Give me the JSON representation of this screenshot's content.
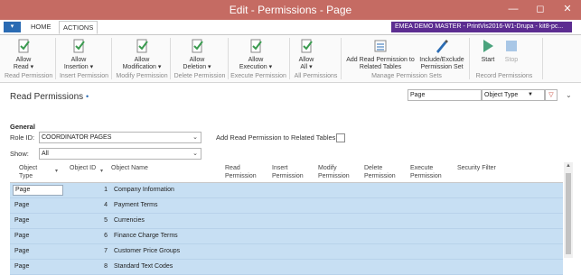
{
  "window": {
    "title": "Edit - Permissions - Page"
  },
  "ribbon_tabs": {
    "home": "HOME",
    "actions": "ACTIONS",
    "app_button": "▾"
  },
  "tenant": "EMEA DEMO MASTER - PrintVis2016-W1-Drupa - kit8-pc...",
  "ribbon": {
    "buttons": [
      {
        "label1": "Allow",
        "label2": "Read ▾",
        "icon": "check-document-icon"
      },
      {
        "label1": "Allow",
        "label2": "Insertion ▾",
        "icon": "check-document-icon"
      },
      {
        "label1": "Allow",
        "label2": "Modification ▾",
        "icon": "check-document-icon"
      },
      {
        "label1": "Allow",
        "label2": "Deletion ▾",
        "icon": "check-document-icon"
      },
      {
        "label1": "Allow",
        "label2": "Execution ▾",
        "icon": "check-document-icon"
      },
      {
        "label1": "Allow",
        "label2": "All ▾",
        "icon": "check-document-icon"
      },
      {
        "label1": "Add Read Permission to",
        "label2": "Related Tables",
        "icon": "list-arrows-icon"
      },
      {
        "label1": "Include/Exclude",
        "label2": "Permission Set",
        "icon": "pen-icon"
      },
      {
        "label1": "Start",
        "label2": "",
        "icon": "play-icon"
      },
      {
        "label1": "Stop",
        "label2": "",
        "icon": "stop-icon"
      }
    ],
    "groups": [
      "Read Permission",
      "Insert Permission",
      "Modify Permission",
      "Delete Permission",
      "Execute Permission",
      "All Permissions",
      "Manage Permission Sets",
      "Record Permissions"
    ]
  },
  "page": {
    "title": "Read Permissions",
    "filter_value": "Page",
    "filter_field": "Object Type"
  },
  "general": {
    "heading": "General",
    "role_id_label": "Role ID:",
    "role_id_value": "COORDINATOR PAGES",
    "show_label": "Show:",
    "show_value": "All",
    "add_related_label": "Add Read Permission to Related Tables:"
  },
  "grid": {
    "columns": [
      {
        "l1": "Object",
        "l2": "Type"
      },
      {
        "l1": "Object ID",
        "l2": ""
      },
      {
        "l1": "Object Name",
        "l2": ""
      },
      {
        "l1": "Read",
        "l2": "Permission"
      },
      {
        "l1": "Insert",
        "l2": "Permission"
      },
      {
        "l1": "Modify",
        "l2": "Permission"
      },
      {
        "l1": "Delete",
        "l2": "Permission"
      },
      {
        "l1": "Execute",
        "l2": "Permission"
      },
      {
        "l1": "Security Filter",
        "l2": ""
      }
    ],
    "rows": [
      {
        "type": "Page",
        "id": "1",
        "name": "Company Information"
      },
      {
        "type": "Page",
        "id": "4",
        "name": "Payment Terms"
      },
      {
        "type": "Page",
        "id": "5",
        "name": "Currencies"
      },
      {
        "type": "Page",
        "id": "6",
        "name": "Finance Charge Terms"
      },
      {
        "type": "Page",
        "id": "7",
        "name": "Customer Price Groups"
      },
      {
        "type": "Page",
        "id": "8",
        "name": "Standard Text Codes"
      }
    ]
  },
  "colors": {
    "titlebar": "#c56b63",
    "tenant": "#5c2d91",
    "accent": "#2a6bb3",
    "row_selected": "#c7dff3"
  }
}
